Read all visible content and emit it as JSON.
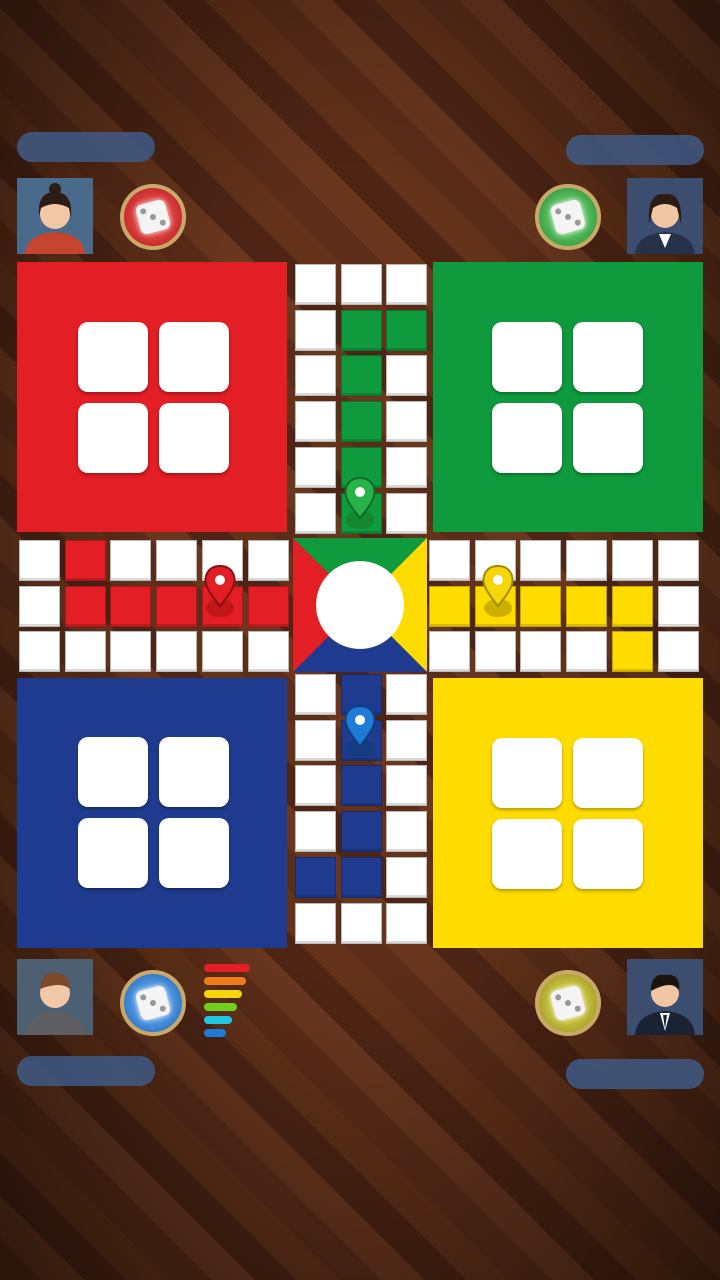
{
  "players": [
    {
      "id": "red",
      "name": "",
      "color": "#e31e24",
      "avatar": "female-avatar-icon",
      "dice_color": "#d92a2a"
    },
    {
      "id": "green",
      "name": "",
      "color": "#0f9a3d",
      "avatar": "businesswoman-avatar-icon",
      "dice_color": "#2fa83c"
    },
    {
      "id": "blue",
      "name": "",
      "color": "#1f3b8f",
      "avatar": "male-hoodie-avatar-icon",
      "dice_color": "#1f7bd6"
    },
    {
      "id": "yellow",
      "name": "",
      "color": "#ffdc00",
      "avatar": "businessman-avatar-icon",
      "dice_color": "#b9b41a"
    }
  ],
  "tokens": [
    {
      "color": "red",
      "icon": "red-token-pin-icon"
    },
    {
      "color": "green",
      "icon": "green-token-pin-icon"
    },
    {
      "color": "yellow",
      "icon": "yellow-token-pin-icon"
    },
    {
      "color": "blue",
      "icon": "blue-token-pin-icon"
    }
  ],
  "power_meter": {
    "levels": [
      "#e31e24",
      "#f07c1a",
      "#f5d60a",
      "#6fd11d",
      "#22c7e5",
      "#1f7bd6"
    ]
  }
}
